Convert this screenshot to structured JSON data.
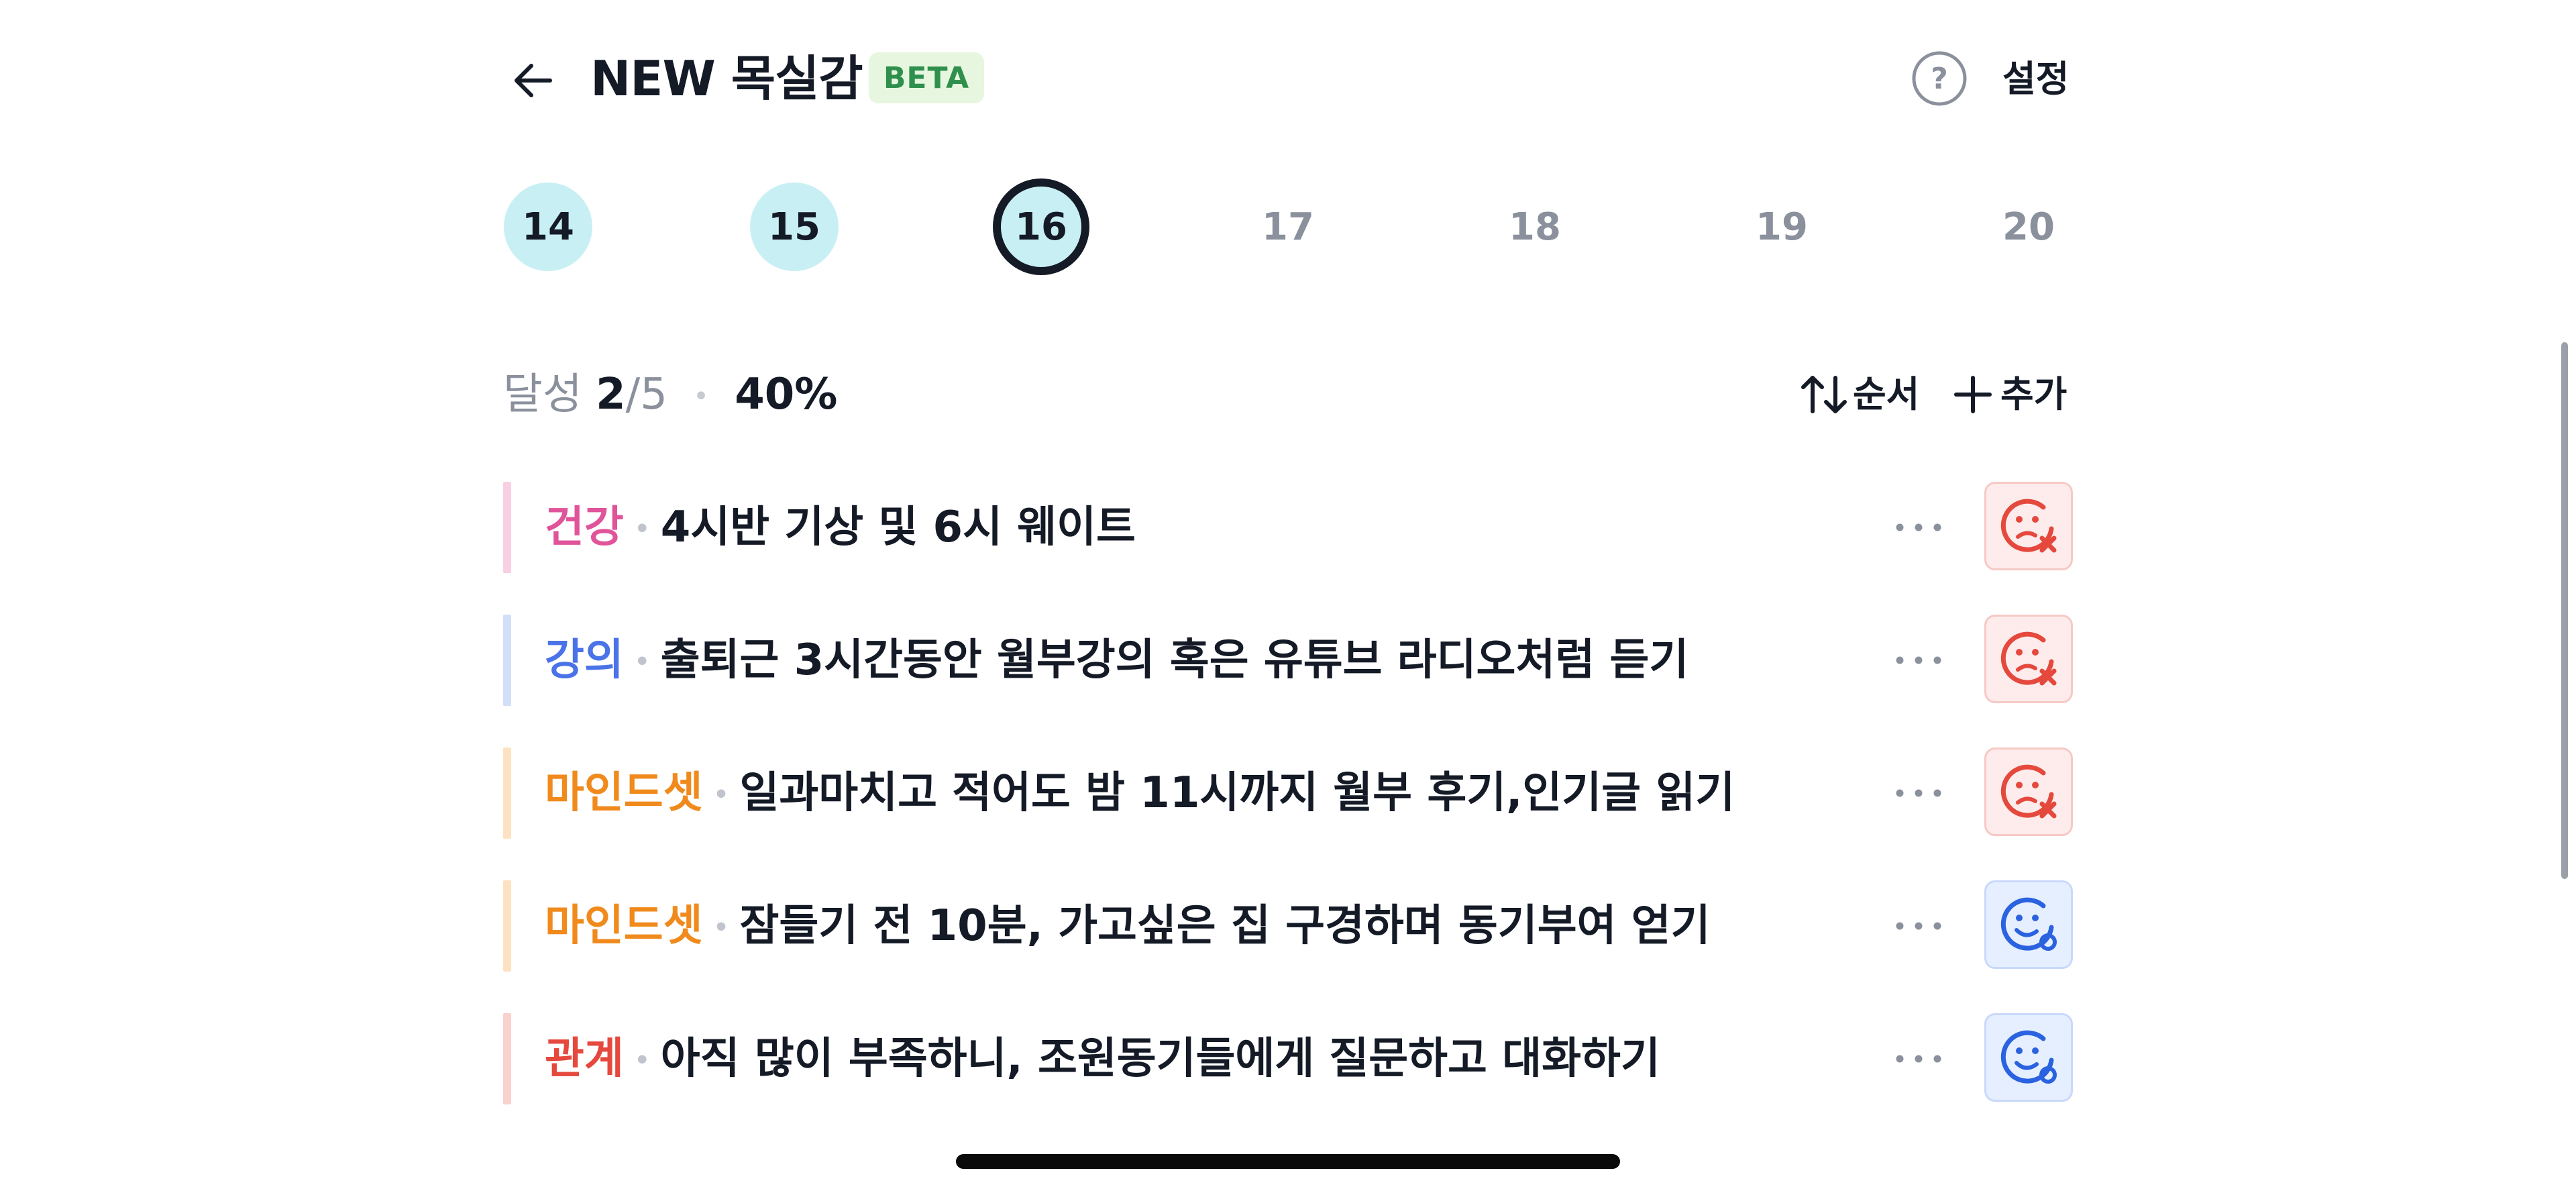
{
  "header": {
    "back_icon": "arrow-left-icon",
    "title": "NEW 목실감",
    "badge": "BETA",
    "help_icon": "question-circle-icon",
    "settings_label": "설정"
  },
  "days": [
    {
      "label": "14",
      "state": "done"
    },
    {
      "label": "15",
      "state": "done"
    },
    {
      "label": "16",
      "state": "today"
    },
    {
      "label": "17",
      "state": "future"
    },
    {
      "label": "18",
      "state": "future"
    },
    {
      "label": "19",
      "state": "future"
    },
    {
      "label": "20",
      "state": "future"
    }
  ],
  "stats": {
    "label": "달성",
    "done": "2",
    "total": "/5",
    "percent": "40%"
  },
  "actions": {
    "order_label": "순서",
    "order_icon": "sort-arrows-icon",
    "add_label": "추가",
    "add_icon": "plus-icon"
  },
  "tasks": [
    {
      "category": "건강",
      "color": "#e0549a",
      "bar": "#f9cfe3",
      "text": "4시반 기상 및 6시 웨이트",
      "status": "fail"
    },
    {
      "category": "강의",
      "color": "#4a73e8",
      "bar": "#d3dff9",
      "text": "출퇴근 3시간동안 월부강의 혹은 유튜브 라디오처럼 듣기",
      "status": "fail"
    },
    {
      "category": "마인드셋",
      "color": "#f08a1c",
      "bar": "#fde2c2",
      "text": "일과마치고 적어도 밤 11시까지 월부 후기,인기글 읽기",
      "status": "fail"
    },
    {
      "category": "마인드셋",
      "color": "#f08a1c",
      "bar": "#fde2c2",
      "text": "잠들기 전 10분, 가고싶은 집 구경하며 동기부여 얻기",
      "status": "ok"
    },
    {
      "category": "관계",
      "color": "#e5483d",
      "bar": "#f9d1cd",
      "text": "아직 많이 부족하니, 조원동기들에게 질문하고 대화하기",
      "status": "ok"
    }
  ],
  "status_icons": {
    "fail": "sad-face-x-icon",
    "ok": "smile-face-check-icon"
  },
  "colors": {
    "fail": "#e5483d",
    "ok": "#2a62e0",
    "today_ring": "#141a26",
    "done_fill": "#c8f0f4"
  }
}
